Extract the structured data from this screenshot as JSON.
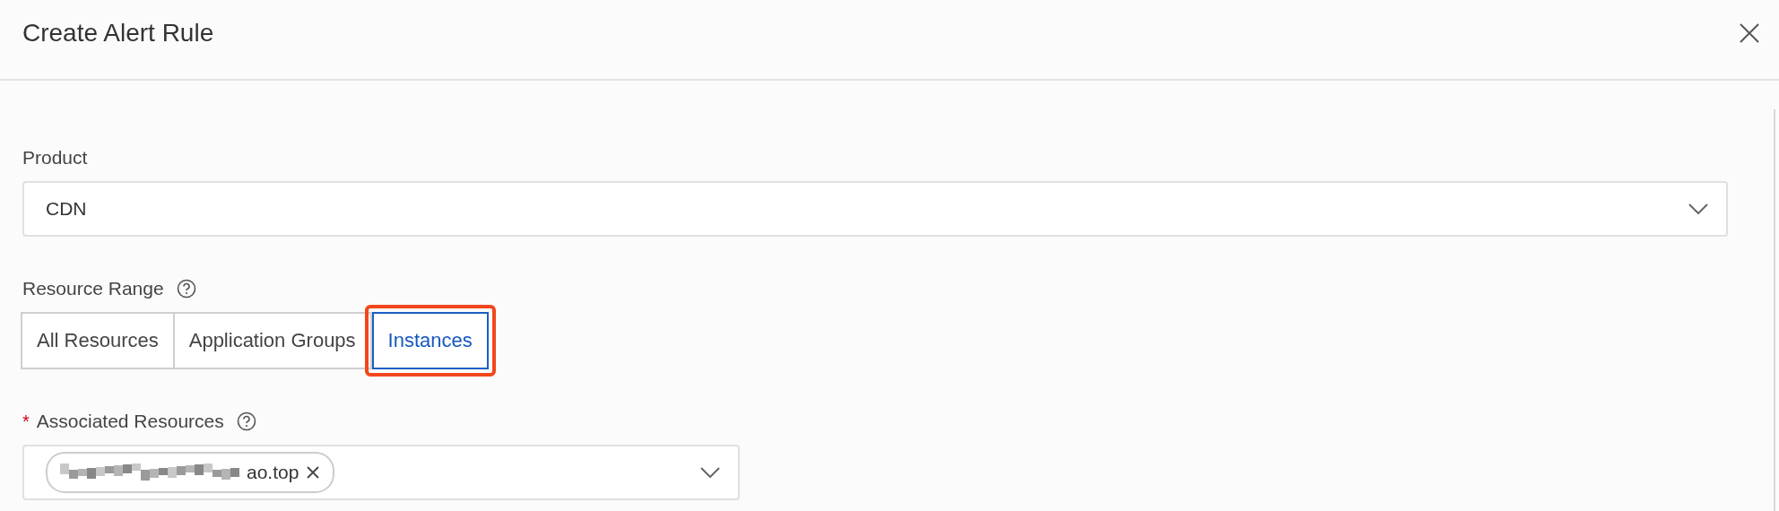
{
  "dialog": {
    "title": "Create Alert Rule"
  },
  "product": {
    "label": "Product",
    "value": "CDN"
  },
  "resource_range": {
    "label": "Resource Range",
    "options": [
      {
        "label": "All Resources",
        "selected": false,
        "highlighted": false
      },
      {
        "label": "Application Groups",
        "selected": false,
        "highlighted": false
      },
      {
        "label": "Instances",
        "selected": true,
        "highlighted": true
      }
    ]
  },
  "associated_resources": {
    "label": "Associated Resources",
    "required_mark": "*",
    "tags": [
      {
        "text": "ao.top",
        "redacted": true
      }
    ]
  }
}
